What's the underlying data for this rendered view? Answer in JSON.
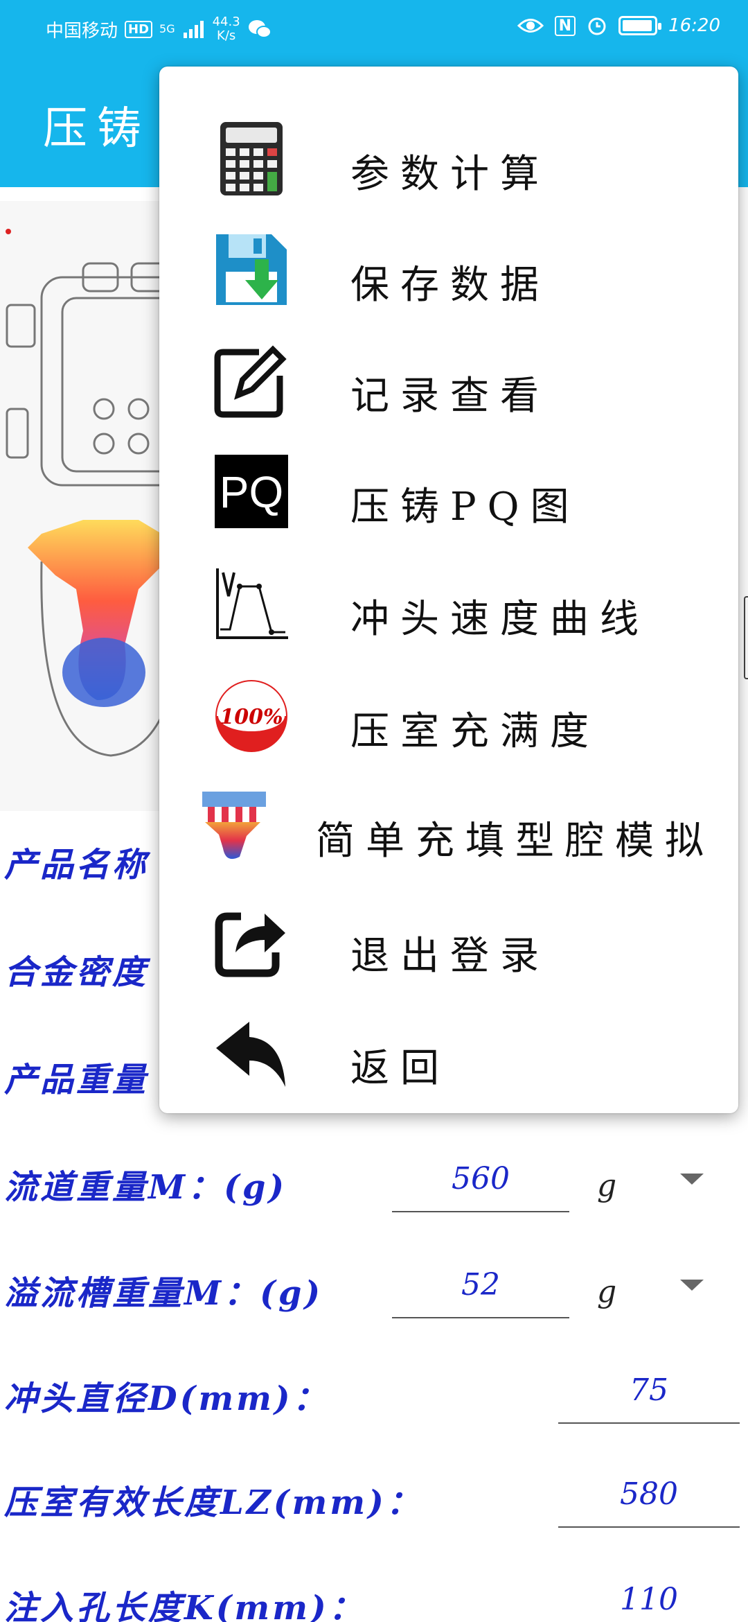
{
  "status_bar": {
    "carrier": "中国移动",
    "hd": "HD",
    "network": "5G",
    "speed_value": "44.3",
    "speed_unit": "K/s",
    "nfc": "N",
    "time": "16:20"
  },
  "appbar": {
    "title": "压铸"
  },
  "menu": {
    "items": [
      {
        "label": "参数计算",
        "icon": "calculator-icon"
      },
      {
        "label": "保存数据",
        "icon": "save-floppy-icon"
      },
      {
        "label": "记录查看",
        "icon": "edit-record-icon"
      },
      {
        "label": "压铸PQ图",
        "icon": "pq-chart-icon",
        "icon_text": "PQ"
      },
      {
        "label": "冲头速度曲线",
        "icon": "speed-curve-icon"
      },
      {
        "label": "压室充满度",
        "icon": "fill-percent-icon",
        "icon_text": "100%"
      },
      {
        "label": "简单充填型腔模拟",
        "icon": "cavity-sim-icon"
      },
      {
        "label": "退出登录",
        "icon": "logout-share-icon"
      },
      {
        "label": "返回",
        "icon": "back-arrow-icon"
      }
    ]
  },
  "form": {
    "product_name_label": "产品名称",
    "alloy_density_label": "合金密度",
    "product_weight_label": "产品重量",
    "runner_weight": {
      "label": "流道重量M：(g)",
      "value": "560",
      "unit": "g"
    },
    "overflow_weight": {
      "label": "溢流槽重量M：(g)",
      "value": "52",
      "unit": "g"
    },
    "plunger_diameter": {
      "label": "冲头直径D(mm)：",
      "value": "75"
    },
    "chamber_length": {
      "label": "压室有效长度LZ(mm)：",
      "value": "580"
    },
    "inlet_length": {
      "label": "注入孔长度K(mm)：",
      "value": "110"
    }
  },
  "colors": {
    "accent": "#16b6ec",
    "form_text": "#1a27c8"
  }
}
